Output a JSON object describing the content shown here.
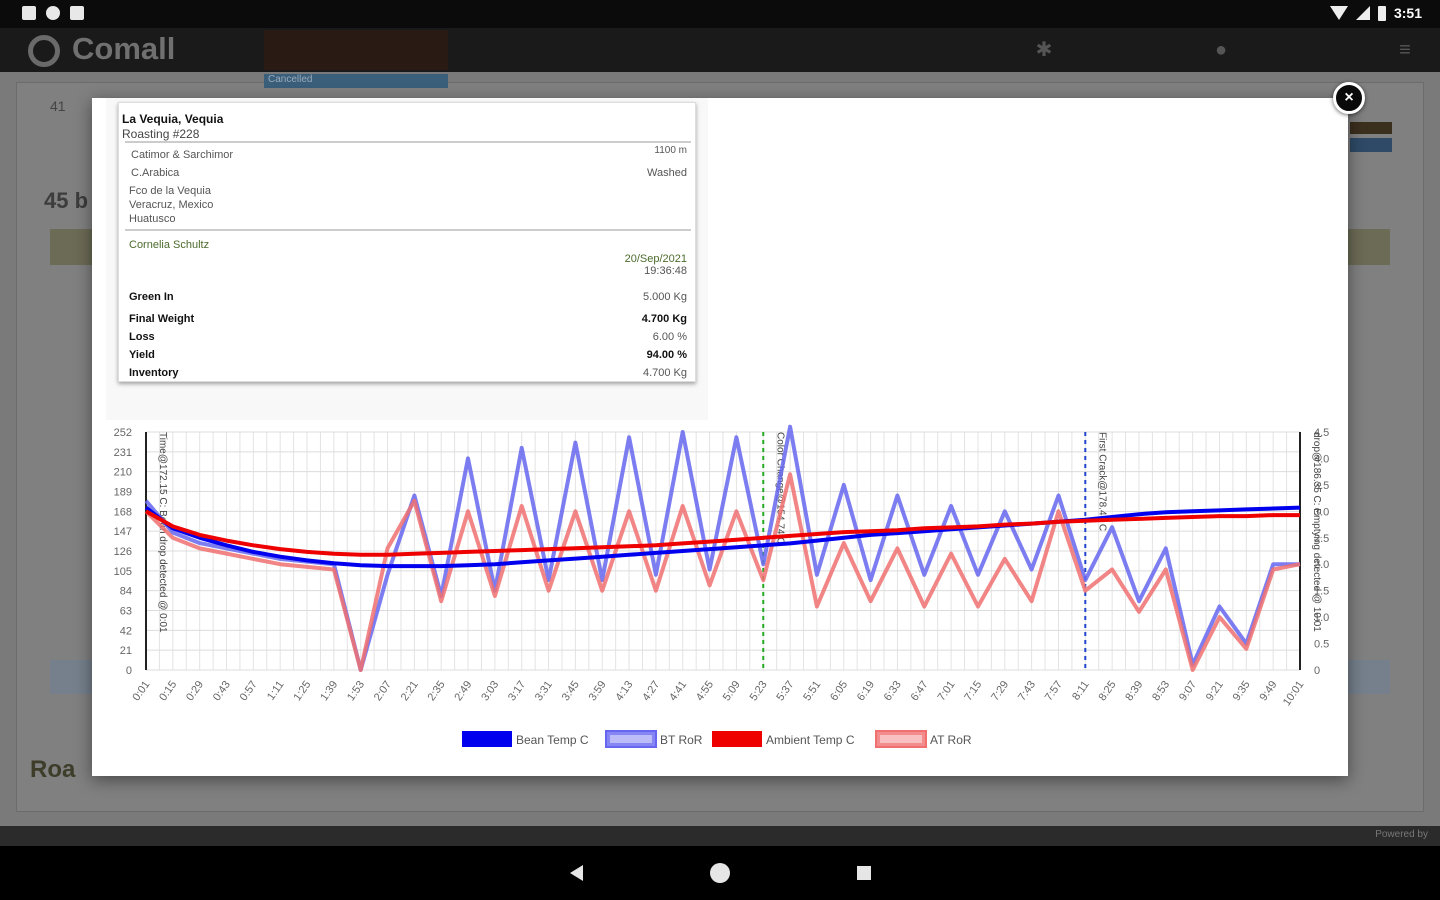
{
  "status_bar": {
    "time": "3:51"
  },
  "app": {
    "brand": "Comall",
    "tab_badge": "Cancelled"
  },
  "background": {
    "row_number": "41",
    "count_title": "45 b",
    "section_title": "Roa",
    "footer_powered": "Powered by"
  },
  "modal": {
    "close_label": "×",
    "info": {
      "title": "La Vequia, Vequia",
      "subtitle": "Roasting #228",
      "varietal": "Catimor & Sarchimor",
      "altitude": "1100 m",
      "species": "C.Arabica",
      "process": "Washed",
      "farm": "Fco de la Vequia",
      "region": "Veracruz, Mexico",
      "town": "Huatusco",
      "roaster": "Cornelia Schultz",
      "date": "20/Sep/2021",
      "time": "19:36:48",
      "metrics": [
        {
          "label": "Green In",
          "value": "5.000 Kg",
          "bold_value": false
        },
        {
          "label": "Final Weight",
          "value": "4.700 Kg",
          "bold_value": true
        },
        {
          "label": "Loss",
          "value": "6.00 %",
          "bold_value": false
        },
        {
          "label": "Yield",
          "value": "94.00 %",
          "bold_value": true
        },
        {
          "label": "Inventory",
          "value": "4.700 Kg",
          "bold_value": false
        }
      ]
    }
  },
  "chart_data": {
    "type": "line",
    "y_left_ticks": [
      "252",
      "231",
      "210",
      "189",
      "168",
      "147",
      "126",
      "105",
      "84",
      "63",
      "42",
      "21",
      "0"
    ],
    "y_right_ticks": [
      "4.5",
      "4.0",
      "3.5",
      "3.0",
      "2.5",
      "2.0",
      "1.5",
      "1.0",
      "0.5",
      "0"
    ],
    "ylim_left": [
      0,
      252
    ],
    "ylim_right": [
      0,
      4.5
    ],
    "x_ticks": [
      "0:01",
      "0:15",
      "0:29",
      "0:43",
      "0:57",
      "1:11",
      "1:25",
      "1:39",
      "1:53",
      "2:07",
      "2:21",
      "2:35",
      "2:49",
      "3:03",
      "3:17",
      "3:31",
      "3:45",
      "3:59",
      "4:13",
      "4:27",
      "4:41",
      "4:55",
      "5:09",
      "5:23",
      "5:37",
      "5:51",
      "6:05",
      "6:19",
      "6:33",
      "6:47",
      "7:01",
      "7:15",
      "7:29",
      "7:43",
      "7:57",
      "8:11",
      "8:25",
      "8:39",
      "8:53",
      "9:07",
      "9:21",
      "9:35",
      "9:49",
      "10:01"
    ],
    "events": [
      {
        "label": "Time@172.15 C: Bean drop detected @ 0:01",
        "x": "0:01",
        "color": "#222222",
        "style": "solid"
      },
      {
        "label": "Color Change@154.74 C",
        "x": "5:23",
        "color": "#22aa22",
        "style": "dashed"
      },
      {
        "label": "First Crack@178.46 C",
        "x": "8:11",
        "color": "#2244cc",
        "style": "dashed"
      },
      {
        "label": "drop@186.35 C: Emptying detected @ 10:01",
        "x": "10:01",
        "color": "#222222",
        "style": "solid"
      }
    ],
    "series": [
      {
        "name": "Bean Temp C",
        "axis": "left",
        "color": "#0000ee",
        "style": "thick",
        "values": [
          172,
          150,
          140,
          132,
          125,
          120,
          116,
          113,
          111,
          110,
          110,
          110,
          111,
          112,
          114,
          116,
          118,
          120,
          122,
          124,
          126,
          128,
          130,
          132,
          134,
          137,
          140,
          143,
          145,
          147,
          149,
          151,
          153,
          155,
          157,
          159,
          162,
          165,
          167,
          168,
          169,
          170,
          171,
          172
        ]
      },
      {
        "name": "BT RoR",
        "axis": "right",
        "color": "#6666f0",
        "style": "band",
        "values": [
          3.2,
          2.6,
          2.4,
          2.3,
          2.2,
          2.1,
          2.05,
          2.0,
          0.0,
          1.8,
          3.3,
          1.4,
          4.0,
          1.5,
          4.2,
          1.7,
          4.3,
          1.7,
          4.4,
          1.8,
          4.5,
          1.9,
          4.4,
          2.0,
          4.6,
          1.8,
          3.5,
          1.7,
          3.3,
          1.8,
          3.1,
          1.8,
          3.0,
          1.9,
          3.3,
          1.7,
          2.7,
          1.3,
          2.3,
          0.1,
          1.2,
          0.5,
          2.0,
          2.0
        ]
      },
      {
        "name": "Ambient Temp C",
        "axis": "left",
        "color": "#ee0000",
        "style": "thick",
        "values": [
          168,
          152,
          143,
          137,
          132,
          128,
          125,
          123,
          122,
          122,
          123,
          124,
          125,
          126,
          127,
          128,
          129,
          130,
          131,
          132,
          134,
          136,
          138,
          140,
          142,
          144,
          146,
          147,
          148,
          150,
          151,
          152,
          154,
          155,
          157,
          158,
          159,
          160,
          161,
          162,
          163,
          163,
          164,
          164
        ]
      },
      {
        "name": "AT RoR",
        "axis": "right",
        "color": "#f07070",
        "style": "band",
        "values": [
          3.0,
          2.5,
          2.3,
          2.2,
          2.1,
          2.0,
          1.95,
          1.9,
          0.0,
          2.3,
          3.2,
          1.3,
          3.0,
          1.4,
          3.1,
          1.5,
          3.0,
          1.5,
          3.0,
          1.5,
          3.1,
          1.6,
          3.0,
          1.7,
          3.7,
          1.2,
          2.4,
          1.3,
          2.3,
          1.2,
          2.2,
          1.2,
          2.1,
          1.3,
          3.0,
          1.5,
          1.9,
          1.1,
          1.9,
          0.0,
          1.0,
          0.4,
          1.9,
          2.0
        ]
      }
    ]
  }
}
